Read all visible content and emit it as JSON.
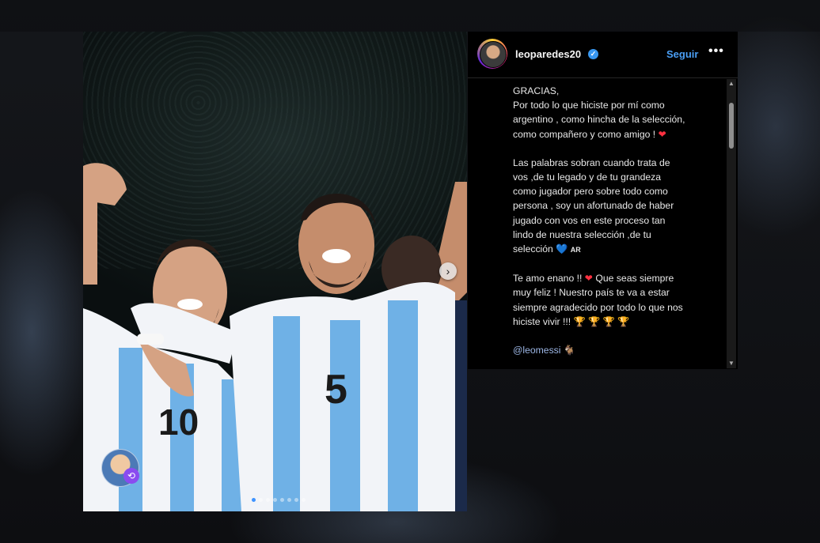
{
  "post": {
    "username": "leoparedes20",
    "follow_label": "Seguir",
    "more_label": "•••",
    "verified_mark": "✓",
    "carousel_next": "›",
    "carousel_dots": 8,
    "carousel_active_dot": 1,
    "tag_badge": "⟲"
  },
  "caption": {
    "p1_line1": "GRACIAS,",
    "p1_line2": "Por todo lo que hiciste por mí como",
    "p1_line3": "argentino , como hincha de la selección,",
    "p1_line4": "como compañero y como amigo ! ",
    "p1_emoji": "❤",
    "p2_line1": "Las palabras sobran cuando  trata de",
    "p2_line2": "vos ,de tu legado y de tu grandeza",
    "p2_line3": "como jugador pero sobre todo como",
    "p2_line4": "persona , soy un afortunado de haber",
    "p2_line5": "jugado con vos en  este proceso tan",
    "p2_line6": "lindo de nuestra selección ,de tu",
    "p2_line7": "selección ",
    "p2_emoji": "💙",
    "p2_flag": "AR",
    "p3_line1_a": "Te amo enano !! ",
    "p3_emoji": "❤",
    "p3_line1_b": " Que seas siempre",
    "p3_line2": "muy feliz ! Nuestro país te va a estar",
    "p3_line3": "siempre agradecido por todo lo que nos",
    "p3_line4": "hiciste vivir !!! ",
    "p3_trophies": "🏆 🏆 🏆 🏆",
    "mention": "@leomessi",
    "mention_emoji": "🐐"
  },
  "colors": {
    "accent": "#4a9ef4",
    "panel_bg": "#000000",
    "heart": "#ff3040"
  }
}
